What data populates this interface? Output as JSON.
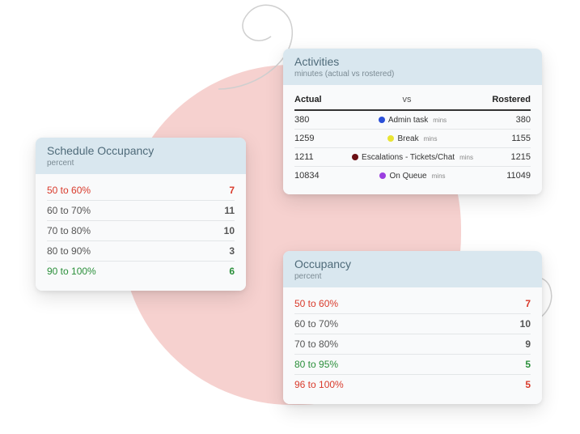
{
  "schedule": {
    "title": "Schedule Occupancy",
    "subtitle": "percent",
    "rows": [
      {
        "label": "50 to 60%",
        "value": "7",
        "tone": "red"
      },
      {
        "label": "60 to 70%",
        "value": "11",
        "tone": ""
      },
      {
        "label": "70 to 80%",
        "value": "10",
        "tone": ""
      },
      {
        "label": "80 to 90%",
        "value": "3",
        "tone": ""
      },
      {
        "label": "90 to 100%",
        "value": "6",
        "tone": "green"
      }
    ]
  },
  "activities": {
    "title": "Activities",
    "subtitle": "minutes (actual vs rostered)",
    "head_actual": "Actual",
    "head_vs": "vs",
    "head_rostered": "Rostered",
    "mins_suffix": "mins",
    "rows": [
      {
        "actual": "380",
        "name": "Admin task",
        "color": "#2a4fd8",
        "rostered": "380"
      },
      {
        "actual": "1259",
        "name": "Break",
        "color": "#e9e433",
        "rostered": "1155"
      },
      {
        "actual": "1211",
        "name": "Escalations - Tickets/Chat",
        "color": "#6b0f14",
        "rostered": "1215"
      },
      {
        "actual": "10834",
        "name": "On Queue",
        "color": "#9b3fe0",
        "rostered": "11049"
      }
    ]
  },
  "occupancy": {
    "title": "Occupancy",
    "subtitle": "percent",
    "rows": [
      {
        "label": "50 to 60%",
        "value": "7",
        "tone": "red"
      },
      {
        "label": "60 to 70%",
        "value": "10",
        "tone": ""
      },
      {
        "label": "70 to 80%",
        "value": "9",
        "tone": ""
      },
      {
        "label": "80 to 95%",
        "value": "5",
        "tone": "green"
      },
      {
        "label": "96 to 100%",
        "value": "5",
        "tone": "red"
      }
    ]
  },
  "chart_data": [
    {
      "type": "table",
      "title": "Schedule Occupancy",
      "ylabel": "percent",
      "categories": [
        "50 to 60%",
        "60 to 70%",
        "70 to 80%",
        "80 to 90%",
        "90 to 100%"
      ],
      "values": [
        7,
        11,
        10,
        3,
        6
      ]
    },
    {
      "type": "table",
      "title": "Activities — minutes (actual vs rostered)",
      "categories": [
        "Admin task",
        "Break",
        "Escalations - Tickets/Chat",
        "On Queue"
      ],
      "series": [
        {
          "name": "Actual",
          "values": [
            380,
            1259,
            1211,
            10834
          ]
        },
        {
          "name": "Rostered",
          "values": [
            380,
            1155,
            1215,
            11049
          ]
        }
      ]
    },
    {
      "type": "table",
      "title": "Occupancy",
      "ylabel": "percent",
      "categories": [
        "50 to 60%",
        "60 to 70%",
        "70 to 80%",
        "80 to 95%",
        "96 to 100%"
      ],
      "values": [
        7,
        10,
        9,
        5,
        5
      ]
    }
  ]
}
